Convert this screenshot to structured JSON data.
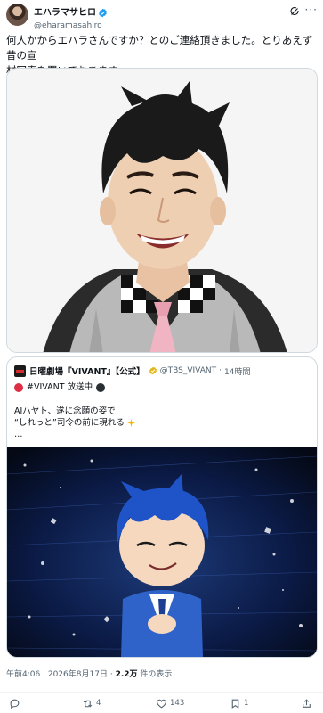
{
  "author": {
    "display_name": "エハラマサヒロ",
    "handle": "@eharamasahiro"
  },
  "tweet": {
    "line1": "何人かからエハラさんですか？とのご連絡頂きました。とりあえず昔の宣",
    "line2": "材写真を置いておきます。"
  },
  "quoted": {
    "display_name": "日曜劇場『VIVANT』【公式】",
    "handle": "@TBS_VIVANT",
    "separator": "·",
    "time": "14時間",
    "line1": "#VIVANT 放送中",
    "line2": "AIハヤト、遂に念願の姿で",
    "line3": "“しれっと”司令の前に現れる",
    "ellipsis": "…"
  },
  "meta": {
    "time": "午前4:06",
    "separator1": "·",
    "date": "2026年8月17日",
    "separator2": "·",
    "views": "2.2万",
    "views_label": "件の表示"
  },
  "actions": {
    "reply_count": "",
    "retweet_count": "4",
    "like_count": "143",
    "bookmark_count": "1"
  },
  "colors": {
    "text": "#0f1419",
    "secondary": "#536471",
    "verified": "#1d9bf0",
    "border": "#cfd9de"
  }
}
